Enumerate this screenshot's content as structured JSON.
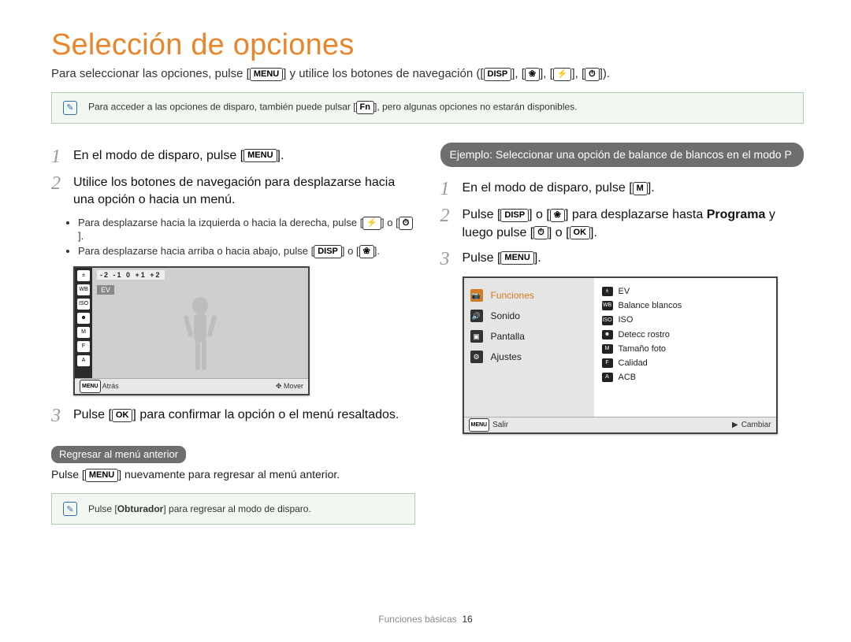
{
  "title": "Selección de opciones",
  "intro": {
    "before": "Para seleccionar las opciones, pulse [",
    "menu_btn": "MENU",
    "after_menu": "] y utilice los botones de navegación ([",
    "disp_btn": "DISP",
    "after_disp": "], [",
    "macro_btn": "❀",
    "between1": "], [",
    "flash_btn": "⚡",
    "between2": "], [",
    "timer_btn": "⏱",
    "close": "]).",
    "rest": ""
  },
  "note1": {
    "before": "Para acceder a las opciones de disparo, también puede pulsar [",
    "fn_btn": "Fn",
    "after": "], pero algunas opciones no estarán disponibles."
  },
  "left": {
    "step1": {
      "num": "1",
      "before": "En el modo de disparo, pulse [",
      "btn": "MENU",
      "after": "]."
    },
    "step2": {
      "num": "2",
      "text": "Utilice los botones de navegación para desplazarse hacia una opción o hacia un menú."
    },
    "step2_bullets": {
      "b1_before": "Para desplazarse hacia la izquierda o hacia la derecha, pulse [",
      "b1_b1": "⚡",
      "b1_mid": "] o [",
      "b1_b2": "⏱",
      "b1_after": "].",
      "b2_before": "Para desplazarse hacia arriba o hacia abajo, pulse [",
      "b2_b1": "DISP",
      "b2_mid": "] o [",
      "b2_b2": "❀",
      "b2_after": "]."
    },
    "lcd": {
      "ev_scale": "-2 -1 0 +1 +2",
      "ev_label": "EV",
      "back_icon": "MENU",
      "back_label": "Atrás",
      "move_icon": "✥",
      "move_label": "Mover"
    },
    "step3": {
      "num": "3",
      "before": "Pulse [",
      "btn": "OK",
      "after": "] para confirmar la opción o el menú resaltados."
    },
    "subhead": "Regresar al menú anterior",
    "subtext_before": "Pulse [",
    "subtext_btn": "MENU",
    "subtext_after": "] nuevamente para regresar al menú anterior.",
    "note2_before": "Pulse [",
    "note2_btn": "Obturador",
    "note2_after": "] para regresar al modo de disparo."
  },
  "right": {
    "example_head": "Ejemplo: Seleccionar una opción de balance de blancos en el modo P",
    "step1": {
      "num": "1",
      "before": "En el modo de disparo, pulse [",
      "btn": "M",
      "after": "]."
    },
    "step2": {
      "num": "2",
      "before": "Pulse [",
      "b1": "DISP",
      "mid1": "] o [",
      "b2": "❀",
      "mid2": "] para desplazarse hasta ",
      "bold": "Programa",
      "mid3": " y luego pulse [",
      "b3": "⏱",
      "mid4": "] o [",
      "b4": "OK",
      "after": "]."
    },
    "step3": {
      "num": "3",
      "before": "Pulse [",
      "btn": "MENU",
      "after": "]."
    },
    "menu_lcd": {
      "left_items": [
        {
          "label": "Funciones",
          "active": true
        },
        {
          "label": "Sonido",
          "active": false
        },
        {
          "label": "Pantalla",
          "active": false
        },
        {
          "label": "Ajustes",
          "active": false
        }
      ],
      "right_items": [
        "EV",
        "Balance blancos",
        "ISO",
        "Detecc rostro",
        "Tamaño foto",
        "Calidad",
        "ACB"
      ],
      "bottom_left_icon": "MENU",
      "bottom_left": "Salir",
      "bottom_right_icon": "▶",
      "bottom_right": "Cambiar"
    }
  },
  "footer": {
    "section": "Funciones básicas",
    "page": "16"
  }
}
